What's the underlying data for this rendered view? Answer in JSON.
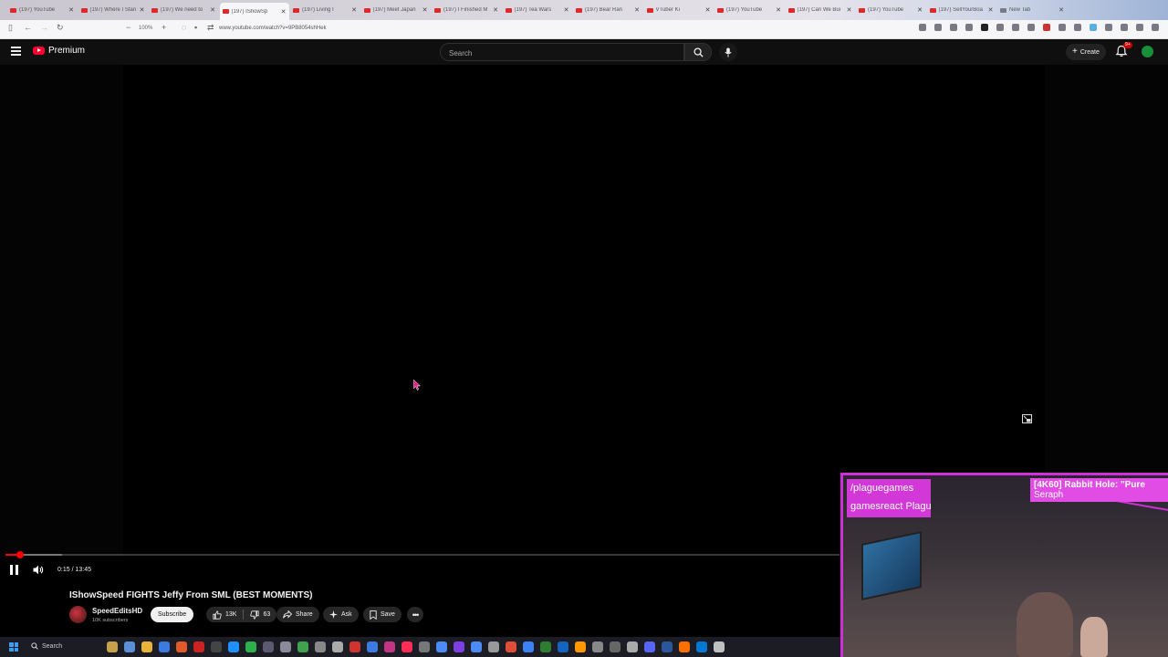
{
  "browser": {
    "tabs": [
      {
        "title": "(197) YouTube",
        "icon": "youtube-icon"
      },
      {
        "title": "(197) Where I Stan",
        "icon": "youtube-icon"
      },
      {
        "title": "(197) We need to",
        "icon": "youtube-icon"
      },
      {
        "title": "(197) IShowSp",
        "icon": "youtube-icon",
        "active": true
      },
      {
        "title": "(197) Living I",
        "icon": "youtube-icon"
      },
      {
        "title": "(197) Meet Japan",
        "icon": "youtube-icon"
      },
      {
        "title": "(197) I Finished M",
        "icon": "youtube-icon"
      },
      {
        "title": "(197) Tea Wars",
        "icon": "youtube-icon"
      },
      {
        "title": "(197) Bear Ran",
        "icon": "youtube-icon"
      },
      {
        "title": "VTuber Ki",
        "icon": "youtube-icon"
      },
      {
        "title": "(197) YouTube",
        "icon": "youtube-icon"
      },
      {
        "title": "(197) Can We Bui",
        "icon": "youtube-icon"
      },
      {
        "title": "(197) YouTube",
        "icon": "youtube-icon"
      },
      {
        "title": "(197) SellYourBoa",
        "icon": "youtube-icon"
      },
      {
        "title": "New Tab",
        "icon": "new-tab-icon"
      }
    ],
    "zoom": "100%",
    "url": "www.youtube.com/watch?v=9PB8054shHek"
  },
  "masthead": {
    "logo_text": "Premium",
    "search_placeholder": "Search",
    "create_label": "Create",
    "notification_badge": "9+"
  },
  "player": {
    "current_time": "0:15",
    "duration": "13:45",
    "time_display": "0:15 / 13:45",
    "played_fraction": 0.018,
    "buffered_fraction": 0.068,
    "state": "playing"
  },
  "video": {
    "title": "IShowSpeed FIGHTS Jeffy From SML (BEST MOMENTS)",
    "channel": "SpeedEditsHD",
    "subscribers": "10K subscribers",
    "subscribe_label": "Subscribe",
    "likes": "13K",
    "dislikes": "63",
    "share_label": "Share",
    "ask_label": "Ask",
    "save_label": "Save"
  },
  "overlay": {
    "name_line1": "/plaguegames",
    "name_line2": "gamesreact Plagu",
    "ad_line1": "[4K60]  Rabbit Hole: \"Pure",
    "ad_line2": "Seraph"
  },
  "taskbar": {
    "search_label": "Search",
    "apps": [
      "#c8a24a",
      "#5b8fd6",
      "#e8b23b",
      "#3b7be0",
      "#e25a2a",
      "#c22",
      "#444",
      "#1e90ff",
      "#2bb24c",
      "#5a5a70",
      "#8a8a9a",
      "#3fa34d",
      "#888",
      "#aaa",
      "#d0342c",
      "#3b7be0",
      "#c13584",
      "#ff2d55",
      "#777",
      "#4c8bf5",
      "#7b3fe4",
      "#4c8bf5",
      "#999",
      "#e04e39",
      "#3b82f6",
      "#2e7d32",
      "#1565c0",
      "#ff9800",
      "#888",
      "#666",
      "#aaa",
      "#5865f2",
      "#2b579a",
      "#ff6f00",
      "#0078d4",
      "#c0c0c0",
      "#ff0000"
    ]
  },
  "colors": {
    "youtube_red": "#ff0033",
    "progress_red": "#ff0000",
    "overlay_magenta": "#cf2fd6"
  }
}
